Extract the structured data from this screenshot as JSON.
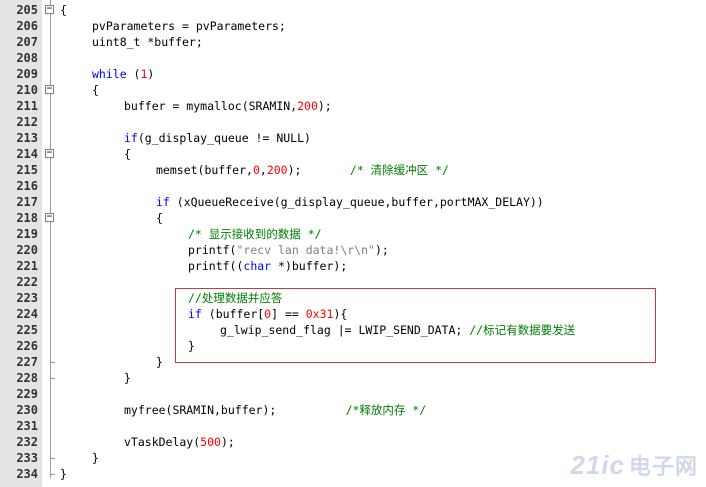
{
  "editor": {
    "lines": [
      {
        "num": "205",
        "fold": "open",
        "indent": 0,
        "tokens": [
          {
            "t": "{",
            "c": ""
          }
        ]
      },
      {
        "num": "206",
        "fold": "",
        "indent": 4,
        "tokens": [
          {
            "t": "pvParameters = pvParameters;",
            "c": ""
          }
        ]
      },
      {
        "num": "207",
        "fold": "",
        "indent": 4,
        "tokens": [
          {
            "t": "uint8_t *buffer;",
            "c": ""
          }
        ]
      },
      {
        "num": "208",
        "fold": "",
        "indent": 0,
        "tokens": []
      },
      {
        "num": "209",
        "fold": "",
        "indent": 4,
        "tokens": [
          {
            "t": "while",
            "c": "kw"
          },
          {
            "t": " (",
            "c": ""
          },
          {
            "t": "1",
            "c": "num"
          },
          {
            "t": ")",
            "c": ""
          }
        ]
      },
      {
        "num": "210",
        "fold": "open",
        "indent": 4,
        "tokens": [
          {
            "t": "{",
            "c": ""
          }
        ]
      },
      {
        "num": "211",
        "fold": "",
        "indent": 8,
        "tokens": [
          {
            "t": "buffer = mymalloc(SRAMIN,",
            "c": ""
          },
          {
            "t": "200",
            "c": "num"
          },
          {
            "t": ");",
            "c": ""
          }
        ]
      },
      {
        "num": "212",
        "fold": "",
        "indent": 0,
        "tokens": []
      },
      {
        "num": "213",
        "fold": "",
        "indent": 8,
        "tokens": [
          {
            "t": "if",
            "c": "kw"
          },
          {
            "t": "(g_display_queue != NULL)",
            "c": ""
          }
        ]
      },
      {
        "num": "214",
        "fold": "open",
        "indent": 8,
        "tokens": [
          {
            "t": "{",
            "c": ""
          }
        ]
      },
      {
        "num": "215",
        "fold": "",
        "indent": 12,
        "tokens": [
          {
            "t": "memset(buffer,",
            "c": ""
          },
          {
            "t": "0",
            "c": "num"
          },
          {
            "t": ",",
            "c": ""
          },
          {
            "t": "200",
            "c": "num"
          },
          {
            "t": ");       ",
            "c": ""
          },
          {
            "t": "/* 清除缓冲区 */",
            "c": "cmt"
          }
        ]
      },
      {
        "num": "216",
        "fold": "",
        "indent": 0,
        "tokens": []
      },
      {
        "num": "217",
        "fold": "",
        "indent": 12,
        "tokens": [
          {
            "t": "if",
            "c": "kw"
          },
          {
            "t": " (xQueueReceive(g_display_queue,buffer,portMAX_DELAY))",
            "c": ""
          }
        ]
      },
      {
        "num": "218",
        "fold": "open",
        "indent": 12,
        "tokens": [
          {
            "t": "{",
            "c": ""
          }
        ]
      },
      {
        "num": "219",
        "fold": "",
        "indent": 16,
        "tokens": [
          {
            "t": "/* 显示接收到的数据 */",
            "c": "cmt"
          }
        ]
      },
      {
        "num": "220",
        "fold": "",
        "indent": 16,
        "tokens": [
          {
            "t": "printf(",
            "c": ""
          },
          {
            "t": "\"recv lan data!\\r\\n\"",
            "c": "str"
          },
          {
            "t": ");",
            "c": ""
          }
        ]
      },
      {
        "num": "221",
        "fold": "",
        "indent": 16,
        "tokens": [
          {
            "t": "printf((",
            "c": ""
          },
          {
            "t": "char",
            "c": "kw"
          },
          {
            "t": " *)buffer);",
            "c": ""
          }
        ]
      },
      {
        "num": "222",
        "fold": "",
        "indent": 0,
        "tokens": []
      },
      {
        "num": "223",
        "fold": "",
        "indent": 16,
        "tokens": [
          {
            "t": "//处理数据并应答",
            "c": "cmt"
          }
        ]
      },
      {
        "num": "224",
        "fold": "",
        "indent": 16,
        "tokens": [
          {
            "t": "if",
            "c": "kw"
          },
          {
            "t": " (buffer[",
            "c": ""
          },
          {
            "t": "0",
            "c": "num"
          },
          {
            "t": "] == ",
            "c": ""
          },
          {
            "t": "0x31",
            "c": "num"
          },
          {
            "t": "){",
            "c": ""
          }
        ]
      },
      {
        "num": "225",
        "fold": "",
        "indent": 20,
        "tokens": [
          {
            "t": "g_lwip_send_flag |= LWIP_SEND_DATA; ",
            "c": ""
          },
          {
            "t": "//标记有数据要发送",
            "c": "cmt"
          }
        ]
      },
      {
        "num": "226",
        "fold": "",
        "indent": 16,
        "tokens": [
          {
            "t": "}",
            "c": ""
          }
        ]
      },
      {
        "num": "227",
        "fold": "close",
        "indent": 12,
        "tokens": [
          {
            "t": "}",
            "c": ""
          }
        ]
      },
      {
        "num": "228",
        "fold": "close",
        "indent": 8,
        "tokens": [
          {
            "t": "}",
            "c": ""
          }
        ]
      },
      {
        "num": "229",
        "fold": "",
        "indent": 0,
        "tokens": []
      },
      {
        "num": "230",
        "fold": "",
        "indent": 8,
        "tokens": [
          {
            "t": "myfree(SRAMIN,buffer);          ",
            "c": ""
          },
          {
            "t": "/*释放内存 */",
            "c": "cmt"
          }
        ]
      },
      {
        "num": "231",
        "fold": "",
        "indent": 0,
        "tokens": []
      },
      {
        "num": "232",
        "fold": "",
        "indent": 8,
        "tokens": [
          {
            "t": "vTaskDelay(",
            "c": ""
          },
          {
            "t": "500",
            "c": "num"
          },
          {
            "t": ");",
            "c": ""
          }
        ]
      },
      {
        "num": "233",
        "fold": "close",
        "indent": 4,
        "tokens": [
          {
            "t": "}",
            "c": ""
          }
        ]
      },
      {
        "num": "234",
        "fold": "close",
        "indent": 0,
        "tokens": [
          {
            "t": "}",
            "c": ""
          }
        ]
      }
    ]
  },
  "watermark": {
    "text": "21ic",
    "text_cn": "电子网"
  },
  "colors": {
    "keyword": "#0000ff",
    "number": "#ff0000",
    "string": "#808080",
    "comment": "#008000",
    "highlight_box": "#c83c3c",
    "gutter": "#e4e4e4"
  }
}
